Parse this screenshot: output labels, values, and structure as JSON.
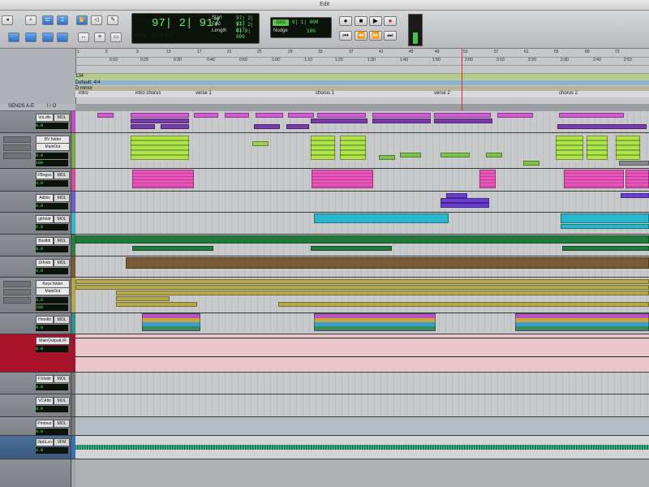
{
  "window": {
    "title": "Edit"
  },
  "counter": {
    "main": "97| 2| 917",
    "start_label": "Start",
    "start_value": "97| 2| 917",
    "end_label": "End",
    "end_value": "97| 2| 917",
    "length_label": "Length",
    "length_value": "0| 0| 000",
    "cursor_label": "Cursor",
    "cursor_value": "52| 4| 210"
  },
  "grid": {
    "label": "Grid",
    "value": "0| 1| 000"
  },
  "nudge": {
    "label": "Nudge",
    "value": "100"
  },
  "rulers": {
    "bars": [
      "1",
      "5",
      "9",
      "13",
      "17",
      "21",
      "25",
      "29",
      "33",
      "37",
      "41",
      "45",
      "49",
      "53",
      "57",
      "61",
      "65",
      "69",
      "73"
    ],
    "times": [
      "0:10",
      "0:20",
      "0:30",
      "0:40",
      "0:50",
      "1:00",
      "1:10",
      "1:20",
      "1:30",
      "1:40",
      "1:50",
      "2:00",
      "2:10",
      "2:20",
      "2:30",
      "2:40",
      "2:53"
    ],
    "tempo": "134",
    "meter": "Default: 4/4",
    "key": "D minor",
    "markers": [
      "intro",
      "intro chorus",
      "verse 1",
      "chorus 1",
      "verse 2",
      "chorus 2"
    ]
  },
  "header": {
    "sends": "SENDS A-E",
    "io": "I / O"
  },
  "tracks": [
    {
      "name": "VoLdfo",
      "io": "MOL",
      "vol": "0.0",
      "color": "#c04fc6"
    },
    {
      "name": "BV folder",
      "io": "MainOut",
      "vol": "0.0",
      "pan": "100",
      "color": "#7aa74b"
    },
    {
      "name": "FBnges",
      "io": "MOL",
      "vol": "0.0",
      "color": "#d44c9f"
    },
    {
      "name": "Adlibs",
      "io": "MOL",
      "vol": "0.0",
      "color": "#6f5bd0"
    },
    {
      "name": "gtrfoldr",
      "io": "MOL",
      "vol": "0.0",
      "color": "#3ab4c8"
    },
    {
      "name": "Bssfldr",
      "io": "MOL",
      "vol": "0.0",
      "color": "#2d7d43"
    },
    {
      "name": "Drfoldr",
      "io": "MOL",
      "vol": "0.0",
      "color": "#7a5a35"
    },
    {
      "name": "Keys folder",
      "io": "MainOut",
      "vol": "0.0",
      "pan": "100",
      "color": "#b2a54c"
    },
    {
      "name": "Hrnsfld",
      "io": "MOL",
      "vol": "0.0",
      "color": "#2f8f8a"
    },
    {
      "name": "MainOutputL/R",
      "io": "",
      "vol": "0.0",
      "color": "#a8132a"
    },
    {
      "name": "FXfoldr",
      "io": "MOL",
      "vol": "0.0",
      "color": "#777"
    },
    {
      "name": "VCAfld",
      "io": "MOL",
      "vol": "0.0",
      "color": "#777"
    },
    {
      "name": "Printout",
      "io": "MOL",
      "vol": "0.0",
      "color": "#777"
    },
    {
      "name": "2tpbLcn",
      "io": "VFM",
      "vol": "0.0",
      "color": "#3e6fb0"
    }
  ]
}
